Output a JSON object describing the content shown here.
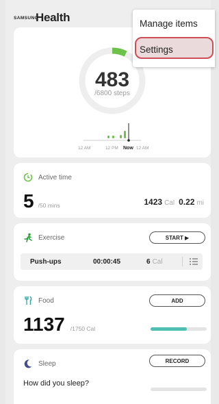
{
  "header": {
    "brand_small": "SAMSUNG",
    "brand_name": "Health"
  },
  "steps": {
    "value": "483",
    "goal": "/6800 steps",
    "progress": 0.071,
    "timeline_labels": [
      "12 AM",
      "12 PM",
      "Now",
      "12 AM"
    ]
  },
  "active_time": {
    "label": "Active time",
    "minutes": "5",
    "goal": "/50 mins",
    "calories": "1423",
    "cal_unit": "Cal",
    "distance": "0.22",
    "distance_unit": "mi"
  },
  "exercise": {
    "label": "Exercise",
    "button": "START ▶",
    "log": {
      "name": "Push-ups",
      "duration": "00:00:45",
      "calories": "6",
      "cal_unit": "Cal"
    }
  },
  "food": {
    "label": "Food",
    "button": "ADD",
    "value": "1137",
    "goal": "/1750 Cal",
    "progress": 0.65
  },
  "sleep": {
    "label": "Sleep",
    "button": "RECORD",
    "question": "How did you sleep?"
  },
  "menu": {
    "items": [
      "Manage items",
      "Settings"
    ],
    "highlighted": "Settings"
  },
  "colors": {
    "ring_progress": "#6cc24a",
    "ring_track": "#eeeeee",
    "food_bar": "#4fbfb2",
    "active_icon": "#6cc24a",
    "exercise_icon": "#2e9f3a",
    "food_icon": "#2aa8a0",
    "sleep_icon": "#444a8c",
    "highlight_border": "#cf4c54"
  }
}
